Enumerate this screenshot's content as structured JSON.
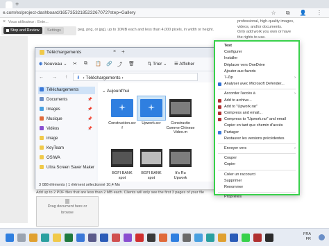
{
  "browser": {
    "new_tab_glyph": "+",
    "address": "e.com/es/project-dashboard/1657353218523267072?step=Gallery",
    "toolbar_icons": "☆ ⧉ 👤 ⋮"
  },
  "recorder": {
    "user_label": "Vous utilisateur : Ente...",
    "close_glyph": "×",
    "stop_label": "Stop and Review",
    "settings_label": "Settings"
  },
  "page": {
    "upload_hint": "peg, png, or jpg), up to 10MB each and less than 4,000 pixels, in width or height.",
    "right_text": [
      "professional, high-quality images,",
      "videos, and/or documents.",
      "",
      "Only add work you own or have",
      "the rights to use."
    ],
    "pdf_hint": "Add up to 2 PDF files that are less than 2 MB each. Clients will only see the first 3 pages of your file",
    "drag_text_1": "Drag document here or",
    "drag_text_2": "browse"
  },
  "explorer": {
    "title": "Téléchargements",
    "close_glyph": "×",
    "plus_glyph": "+",
    "new_label": "Nouveau",
    "sort_label": "Trier",
    "view_label": "Afficher",
    "toolbar_glyphs": [
      "✂",
      "⧉",
      "📋",
      "🔗",
      "⤴",
      "🗑"
    ],
    "nav_arrows": "← → ↑ ⟳",
    "path_label": "Téléchargements",
    "nav": [
      {
        "label": "Téléchargements",
        "color": "#3a78d8",
        "pinned": false,
        "selected": true
      },
      {
        "label": "Documents",
        "color": "#6b8fc7",
        "pinned": true,
        "selected": false
      },
      {
        "label": "Images",
        "color": "#49a0e0",
        "pinned": true,
        "selected": false
      },
      {
        "label": "Musique",
        "color": "#e06a3a",
        "pinned": true,
        "selected": false
      },
      {
        "label": "Vidéos",
        "color": "#8a4fd0",
        "pinned": true,
        "selected": false
      },
      {
        "label": "image",
        "color": "#f0c94a",
        "pinned": false,
        "selected": false
      },
      {
        "label": "KeyTeam",
        "color": "#f0c94a",
        "pinned": false,
        "selected": false
      },
      {
        "label": "OSIWA",
        "color": "#f0c94a",
        "pinned": false,
        "selected": false
      },
      {
        "label": "Ultra Screen Saver Maker",
        "color": "#f0c94a",
        "pinned": false,
        "selected": false
      }
    ],
    "group_label": "Aujourd'hui",
    "files_row1": [
      {
        "name": "Construction.scr",
        "extra": "f",
        "kind": "screen",
        "selected": false
      },
      {
        "name": "Upwork.scr",
        "extra": "",
        "kind": "screen",
        "selected": true
      },
      {
        "name": "Constructio Comme Chinese Video.m",
        "extra": "",
        "kind": "video",
        "selected": false
      }
    ],
    "files_row2": [
      {
        "name": "BGFI BANK",
        "extra": "spot",
        "kind": "video-dark",
        "selected": false
      },
      {
        "name": "BGFI BANK",
        "extra": "spot",
        "kind": "video-light",
        "selected": false
      },
      {
        "name": "It's Ru",
        "extra": "Upwork",
        "kind": "video",
        "selected": false
      }
    ],
    "status": "3 088 éléments | 1 élément sélectionné 10,4 Mo"
  },
  "context_menu": {
    "items": [
      {
        "label": "Test",
        "bold": true,
        "icon": null,
        "arrow": false
      },
      {
        "label": "Configurer",
        "icon": null,
        "arrow": false
      },
      {
        "label": "Installer",
        "icon": null,
        "arrow": false
      },
      {
        "label": "Déplacer vers OneDrive",
        "icon": null,
        "arrow": false
      },
      {
        "label": "Ajouter aux favoris",
        "icon": null,
        "arrow": false
      },
      {
        "label": "7-Zip",
        "icon": null,
        "arrow": true
      },
      {
        "label": "Analyser avec Microsoft Defender...",
        "icon": "#2f6fd0",
        "arrow": false
      },
      {
        "sep": true
      },
      {
        "label": "Accorder l'accès à",
        "icon": null,
        "arrow": true
      },
      {
        "label": "Add to archive...",
        "icon": "#b03030",
        "arrow": false
      },
      {
        "label": "Add to \"Upwork.rar\"",
        "icon": "#b03030",
        "arrow": false
      },
      {
        "label": "Compress and email...",
        "icon": "#b03030",
        "arrow": false
      },
      {
        "label": "Compress to \"Upwork.rar\" and email",
        "icon": "#b03030",
        "arrow": false
      },
      {
        "label": "Copier en tant que chemin d'accès",
        "icon": null,
        "arrow": false
      },
      {
        "label": "Partager",
        "icon": "#3a78d8",
        "arrow": false
      },
      {
        "label": "Restaurer les versions précédentes",
        "icon": null,
        "arrow": false
      },
      {
        "sep": true
      },
      {
        "label": "Envoyer vers",
        "icon": null,
        "arrow": true
      },
      {
        "sep": true
      },
      {
        "label": "Couper",
        "icon": null,
        "arrow": false
      },
      {
        "label": "Copier",
        "icon": null,
        "arrow": false
      },
      {
        "sep": true
      },
      {
        "label": "Créer un raccourci",
        "icon": null,
        "arrow": false
      },
      {
        "label": "Supprimer",
        "icon": null,
        "arrow": false
      },
      {
        "label": "Renommer",
        "icon": null,
        "arrow": false
      },
      {
        "sep": true
      },
      {
        "label": "Propriétés",
        "icon": null,
        "arrow": false
      }
    ],
    "highlight_color": "#38d14b"
  },
  "taskbar": {
    "apps": [
      {
        "name": "start-icon",
        "color": "#2f7fe0"
      },
      {
        "name": "search-icon",
        "color": "#9aa3b0"
      },
      {
        "name": "chrome-icon",
        "color": "#e0a030"
      },
      {
        "name": "edge-icon",
        "color": "#2aa0a0"
      },
      {
        "name": "folder-icon",
        "color": "#f0c94a"
      },
      {
        "name": "excel-icon",
        "color": "#1f7a3f"
      },
      {
        "name": "mail-icon",
        "color": "#3a78d8"
      },
      {
        "name": "store-icon",
        "color": "#5a5a8a"
      },
      {
        "name": "word-icon",
        "color": "#2b5cb8"
      },
      {
        "name": "app-icon",
        "color": "#d05050"
      },
      {
        "name": "app-icon",
        "color": "#8a4fd0"
      },
      {
        "name": "acrobat-icon",
        "color": "#d03030"
      },
      {
        "name": "app-icon",
        "color": "#3a3a3a"
      },
      {
        "name": "app-icon",
        "color": "#e06a3a"
      },
      {
        "name": "app-icon",
        "color": "#2f7fe0"
      },
      {
        "name": "app-icon",
        "color": "#6b6b6b"
      },
      {
        "name": "app-icon",
        "color": "#49a0e0"
      },
      {
        "name": "app-icon",
        "color": "#2aa0a0"
      },
      {
        "name": "app-icon",
        "color": "#e0a030"
      },
      {
        "name": "app-icon",
        "color": "#2b5cb8"
      },
      {
        "name": "app-icon",
        "color": "#38d14b"
      },
      {
        "name": "app-icon",
        "color": "#b03030"
      },
      {
        "name": "app-icon",
        "color": "#2b2b2b"
      }
    ],
    "lang_1": "FRA",
    "lang_2": "FR"
  }
}
